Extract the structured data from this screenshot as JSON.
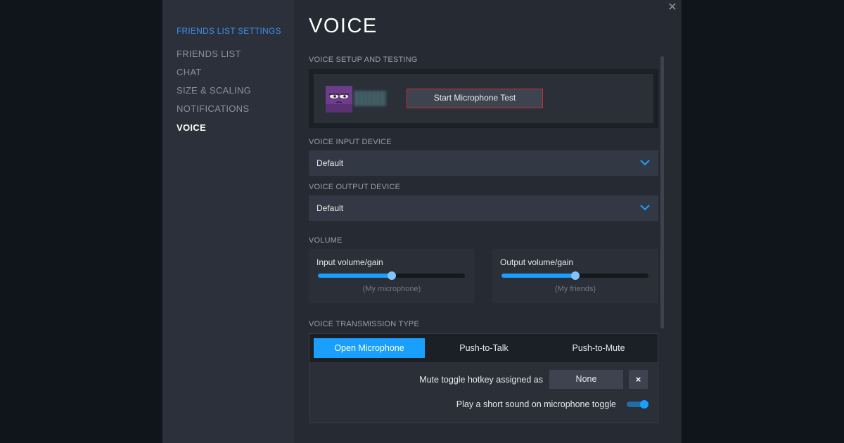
{
  "sidebar": {
    "title": "FRIENDS LIST SETTINGS",
    "items": [
      {
        "label": "FRIENDS LIST",
        "active": false
      },
      {
        "label": "CHAT",
        "active": false
      },
      {
        "label": "SIZE & SCALING",
        "active": false
      },
      {
        "label": "NOTIFICATIONS",
        "active": false
      },
      {
        "label": "VOICE",
        "active": true
      }
    ]
  },
  "close_icon": "close-icon",
  "page": {
    "title": "VOICE"
  },
  "setup": {
    "label": "VOICE SETUP AND TESTING",
    "mic_test_button": "Start Microphone Test"
  },
  "input_device": {
    "label": "VOICE INPUT DEVICE",
    "value": "Default"
  },
  "output_device": {
    "label": "VOICE OUTPUT DEVICE",
    "value": "Default"
  },
  "volume": {
    "label": "VOLUME",
    "input": {
      "label": "Input volume/gain",
      "sub": "(My microphone)",
      "level": 0.5
    },
    "output": {
      "label": "Output volume/gain",
      "sub": "(My friends)",
      "level": 0.5
    }
  },
  "transmission": {
    "label": "VOICE TRANSMISSION TYPE",
    "tabs": [
      {
        "label": "Open Microphone",
        "active": true
      },
      {
        "label": "Push-to-Talk",
        "active": false
      },
      {
        "label": "Push-to-Mute",
        "active": false
      }
    ],
    "hotkey_label": "Mute toggle hotkey assigned as",
    "hotkey_value": "None",
    "clear_icon": "×",
    "sound_label": "Play a short sound on microphone toggle",
    "sound_enabled": true
  },
  "colors": {
    "accent": "#1a9fff",
    "highlight_border": "#d22a2a",
    "sidebar_title": "#3d8ee8"
  }
}
